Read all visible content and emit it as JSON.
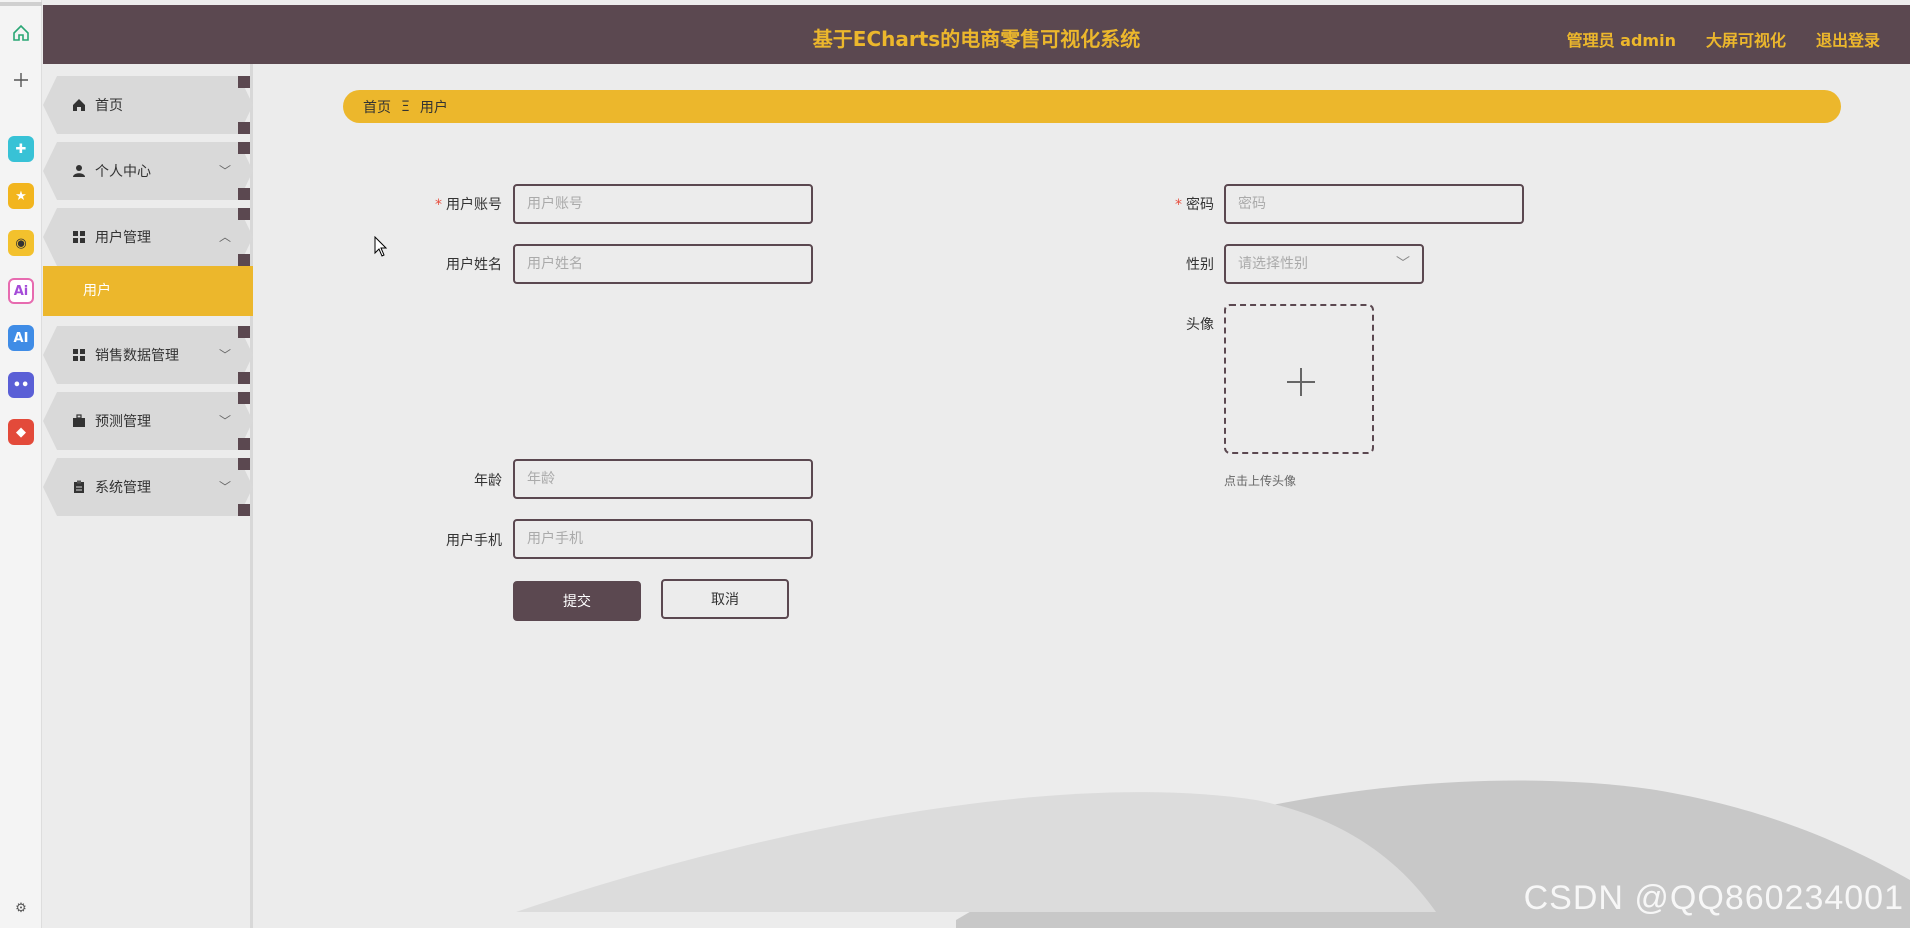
{
  "header": {
    "title": "基于ECharts的电商零售可视化系统",
    "admin": "管理员 admin",
    "screen": "大屏可视化",
    "logout": "退出登录"
  },
  "sidebar": {
    "items": [
      {
        "label": "首页",
        "icon": "home-icon"
      },
      {
        "label": "个人中心",
        "icon": "person-icon"
      },
      {
        "label": "用户管理",
        "icon": "grid-icon"
      },
      {
        "label": "销售数据管理",
        "icon": "grid-icon"
      },
      {
        "label": "预测管理",
        "icon": "briefcase-icon"
      },
      {
        "label": "系统管理",
        "icon": "clipboard-icon"
      }
    ],
    "sub_item": "用户"
  },
  "breadcrumb": {
    "home": "首页",
    "sep": "Ξ",
    "current": "用户"
  },
  "form": {
    "account_label": "用户账号",
    "account_placeholder": "用户账号",
    "password_label": "密码",
    "password_placeholder": "密码",
    "name_label": "用户姓名",
    "name_placeholder": "用户姓名",
    "gender_label": "性别",
    "gender_placeholder": "请选择性别",
    "avatar_label": "头像",
    "avatar_hint": "点击上传头像",
    "age_label": "年龄",
    "age_placeholder": "年龄",
    "phone_label": "用户手机",
    "phone_placeholder": "用户手机",
    "required_mark": "*",
    "submit": "提交",
    "cancel": "取消"
  },
  "watermark": "CSDN @QQ860234001",
  "colors": {
    "header": "#5b4850",
    "accent": "#ecb72c",
    "background": "#ececec"
  }
}
